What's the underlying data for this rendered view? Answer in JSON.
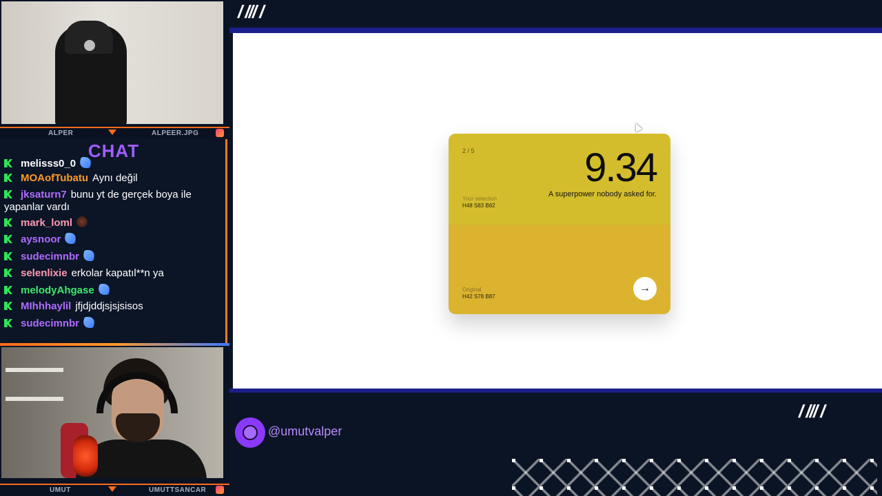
{
  "cams": {
    "top_name": "ALPER",
    "top_handle": "ALPEER.JPG",
    "bottom_name": "UMUT",
    "bottom_handle": "UMUTTSANCAR"
  },
  "chat": {
    "title": "CHAT",
    "messages": [
      {
        "user": "melisss0_0",
        "color": "#ffffff",
        "text": "",
        "emote": "wing"
      },
      {
        "user": "MOAofTubatu",
        "color": "#ff9a2a",
        "text": "Aynı değil",
        "emote": ""
      },
      {
        "user": "jksaturn7",
        "color": "#b06bff",
        "text": "bunu yt de gerçek boya ile yapanlar vardı",
        "emote": ""
      },
      {
        "user": "mark_loml",
        "color": "#ff9ab0",
        "text": "",
        "emote": "ball"
      },
      {
        "user": "aysnoor",
        "color": "#b06bff",
        "text": "",
        "emote": "wing"
      },
      {
        "user": "sudecimnbr",
        "color": "#b06bff",
        "text": "",
        "emote": "wing"
      },
      {
        "user": "selenlixie",
        "color": "#ff9ab0",
        "text": "erkolar kapatıl**n ya",
        "emote": ""
      },
      {
        "user": "melodyAhgase",
        "color": "#3ee86a",
        "text": "",
        "emote": "wing"
      },
      {
        "user": "MIhhhaylil",
        "color": "#b06bff",
        "text": "jfjdjddjsjsjsisos",
        "emote": ""
      },
      {
        "user": "sudecimnbr",
        "color": "#b06bff",
        "text": "",
        "emote": "wing"
      }
    ]
  },
  "overlay": {
    "slashes_top": "/ /// /",
    "slashes_bottom": "/ /// /",
    "handle": "@umutvalper"
  },
  "card": {
    "counter": "2 / 5",
    "score": "9.34",
    "tagline": "A superpower nobody asked for.",
    "selection_label": "Your selection",
    "selection_value": "H48 S83 B82",
    "original_label": "Original",
    "original_value": "H42 S78 B87",
    "next_symbol": "→"
  },
  "colors": {
    "selection": "#d4bd2d",
    "original": "#dcb32f",
    "accent": "#8a3aff"
  }
}
